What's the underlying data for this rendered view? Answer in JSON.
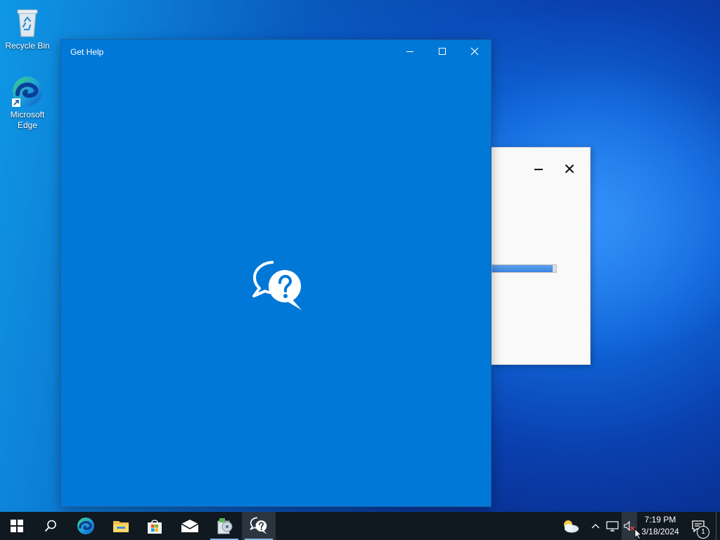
{
  "desktop": {
    "icons": [
      {
        "label": "Recycle Bin",
        "icon": "recycle-bin-icon"
      },
      {
        "label": "Microsoft Edge",
        "icon": "edge-icon"
      }
    ]
  },
  "app_window": {
    "title": "Get Help",
    "splash_icon": "help-chat-bubbles-icon",
    "controls": {
      "minimize": "minimize-icon",
      "maximize": "maximize-icon",
      "close": "close-icon"
    },
    "background_color": "#0078d7"
  },
  "background_dialog": {
    "controls": {
      "minimize": "minimize-icon",
      "close": "close-icon"
    },
    "progress_fraction": 0.95
  },
  "taskbar": {
    "buttons": [
      {
        "name": "start",
        "icon": "windows-logo-icon"
      },
      {
        "name": "search",
        "icon": "search-icon"
      },
      {
        "name": "edge",
        "icon": "edge-icon"
      },
      {
        "name": "file-explorer",
        "icon": "folder-icon"
      },
      {
        "name": "store",
        "icon": "store-bag-icon"
      },
      {
        "name": "mail",
        "icon": "mail-icon"
      },
      {
        "name": "setup",
        "icon": "installer-icon"
      },
      {
        "name": "get-help",
        "icon": "help-chat-bubbles-icon",
        "active": true
      }
    ],
    "tray": {
      "weather_icon": "weather-cloud-sun-icon",
      "chevron_icon": "chevron-up-icon",
      "network_icon": "network-icon",
      "volume_icon": "volume-muted-icon"
    },
    "clock": {
      "time": "7:19 PM",
      "date": "3/18/2024"
    },
    "notifications": {
      "count": "1",
      "icon": "action-center-icon"
    }
  }
}
